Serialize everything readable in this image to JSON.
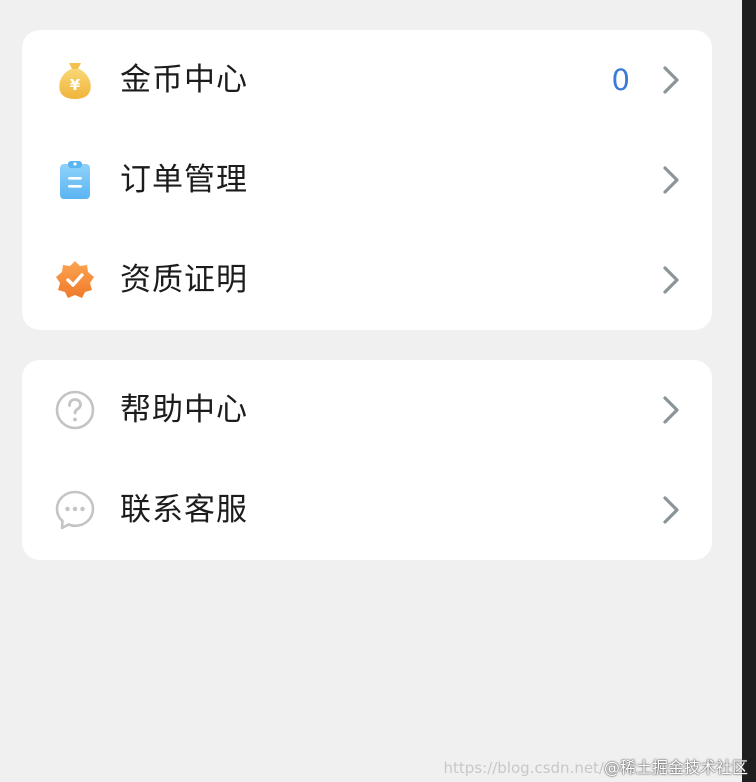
{
  "menu_group_1": {
    "items": [
      {
        "label": "金币中心",
        "value": "0",
        "icon": "money-bag-icon"
      },
      {
        "label": "订单管理",
        "icon": "clipboard-icon"
      },
      {
        "label": "资质证明",
        "icon": "verified-badge-icon"
      }
    ]
  },
  "menu_group_2": {
    "items": [
      {
        "label": "帮助中心",
        "icon": "help-circle-icon"
      },
      {
        "label": "联系客服",
        "icon": "chat-bubble-icon"
      }
    ]
  },
  "watermark": {
    "url_text": "https://blog.csdn.net/",
    "brand_text": "@稀土掘金技术社区"
  },
  "colors": {
    "background": "#f0f0f0",
    "card": "#ffffff",
    "value_accent": "#3a7bd5",
    "chevron": "#8a9499"
  }
}
